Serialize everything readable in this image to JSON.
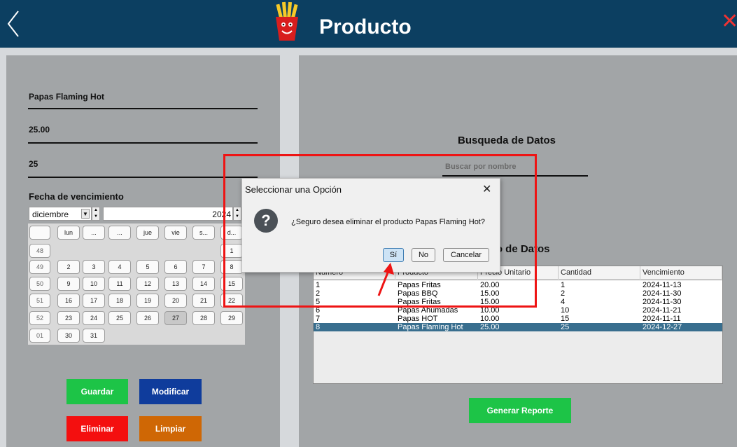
{
  "header": {
    "title": "Producto"
  },
  "form": {
    "name_value": "Papas Flaming Hot",
    "price_value": "25.00",
    "quantity_value": "25",
    "date_label": "Fecha de vencimiento"
  },
  "calendar": {
    "month": "diciembre",
    "year": "2024",
    "weekday_headers": [
      "",
      "lun",
      "...",
      "...",
      "jue",
      "vie",
      "s...",
      "d..."
    ],
    "week_numbers": [
      "48",
      "49",
      "50",
      "51",
      "52",
      "01"
    ],
    "rows": [
      [
        "",
        "",
        "",
        "",
        "",
        "",
        "1"
      ],
      [
        "2",
        "3",
        "4",
        "5",
        "6",
        "7",
        "8"
      ],
      [
        "9",
        "10",
        "11",
        "12",
        "13",
        "14",
        "15"
      ],
      [
        "16",
        "17",
        "18",
        "19",
        "20",
        "21",
        "22"
      ],
      [
        "23",
        "24",
        "25",
        "26",
        "27",
        "28",
        "29"
      ],
      [
        "30",
        "31",
        "",
        "",
        "",
        "",
        ""
      ]
    ],
    "selected_day": "27"
  },
  "buttons": {
    "guardar": "Guardar",
    "modificar": "Modificar",
    "eliminar": "Eliminar",
    "limpiar": "Limpiar",
    "reporte": "Generar Reporte"
  },
  "search": {
    "title": "Busqueda de Datos",
    "placeholder": "Buscar por nombre"
  },
  "registry": {
    "title_visible": "ro de Datos"
  },
  "table": {
    "headers": [
      "Numero",
      "Producto",
      "Precio Unitario",
      "Cantidad",
      "Vencimiento"
    ],
    "rows": [
      [
        "1",
        "Papas Fritas",
        "20.00",
        "1",
        "2024-11-13"
      ],
      [
        "2",
        "Papas BBQ",
        "15.00",
        "2",
        "2024-11-30"
      ],
      [
        "5",
        "Papas Fritas",
        "15.00",
        "4",
        "2024-11-30"
      ],
      [
        "6",
        "Papas Ahumadas",
        "10.00",
        "10",
        "2024-11-21"
      ],
      [
        "7",
        "Papas HOT",
        "10.00",
        "15",
        "2024-11-11"
      ],
      [
        "8",
        "Papas Flaming Hot",
        "25.00",
        "25",
        "2024-12-27"
      ]
    ],
    "selected_row": 5
  },
  "dialog": {
    "title": "Seleccionar una Opción",
    "message": "¿Seguro desea eliminar el producto Papas Flaming Hot?",
    "yes_label": "Sí",
    "no_label": "No",
    "cancel_label": "Cancelar"
  },
  "colors": {
    "header_bg": "#0c3f61",
    "panel_bg": "#a2a5a7",
    "guardar": "#1dc447",
    "modificar": "#0f3c9c",
    "eliminar": "#f40f0f",
    "limpiar": "#cf6705",
    "annotation": "#ee1414"
  }
}
